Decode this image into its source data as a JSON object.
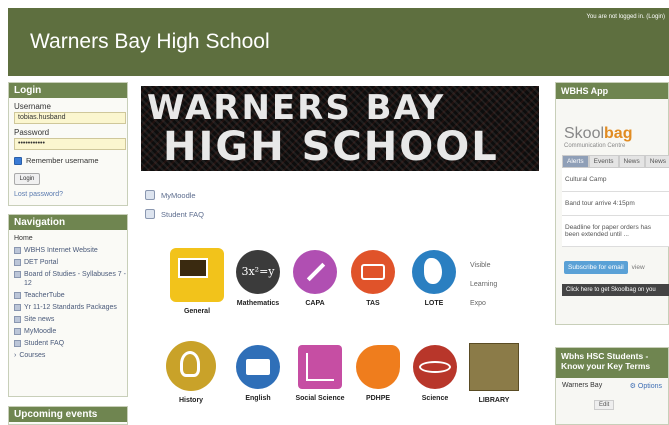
{
  "header": {
    "title": "Warners Bay High School",
    "login_info": "You are not logged in. (Login)"
  },
  "login": {
    "heading": "Login",
    "username_label": "Username",
    "username_value": "tobias.husband",
    "password_label": "Password",
    "password_value": "•••••••••••",
    "remember_label": "Remember username",
    "button_label": "Login",
    "lost_password": "Lost password?"
  },
  "navigation": {
    "heading": "Navigation",
    "items": [
      "Home",
      "WBHS Internet Website",
      "DET Portal",
      "Board of Studies - Syllabuses 7 - 12",
      "TeacherTube",
      "Yr 11-12 Standards Packages",
      "Site news",
      "MyMoodle",
      "Student FAQ",
      "Courses"
    ]
  },
  "upcoming": {
    "heading": "Upcoming events"
  },
  "banner": {
    "line1": "WARNERS BAY",
    "line2": "HIGH SCHOOL"
  },
  "center_links": [
    "MyMoodle",
    "Student FAQ"
  ],
  "subjects": [
    {
      "label": "General",
      "color": "#f2c31b"
    },
    {
      "label": "Mathematics",
      "color": "#3b3b3b",
      "glyph": "3x²=y"
    },
    {
      "label": "CAPA",
      "color": "#b04fb2"
    },
    {
      "label": "TAS",
      "color": "#e0532a"
    },
    {
      "label": "LOTE",
      "color": "#2a7fc1"
    },
    {
      "label": "History",
      "color": "#c9a229"
    },
    {
      "label": "English",
      "color": "#2f6fb8"
    },
    {
      "label": "Social Science",
      "color": "#c64ea3"
    },
    {
      "label": "PDHPE",
      "color": "#ef7d1d"
    },
    {
      "label": "Science",
      "color": "#b8362a"
    },
    {
      "label": "LIBRARY",
      "color": "#8b7b48"
    }
  ],
  "side_words": [
    "Visible",
    "Learning",
    "Expo"
  ],
  "app": {
    "heading": "WBHS App",
    "logo_a": "Skool",
    "logo_b": "bag",
    "logo_sub": "Communication Centre",
    "tabs": [
      "Alerts",
      "Events",
      "News",
      "News"
    ],
    "items": [
      "Cultural Camp",
      "Band tour arrive 4:15pm",
      "Deadline for paper orders has been extended until ..."
    ],
    "subscribe": "Subscribe for email",
    "view": "view",
    "get": "Click here to get Skoolbag on you"
  },
  "terms": {
    "heading": "Wbhs HSC Students - Know your Key Terms",
    "location": "Warners Bay",
    "options": "Options",
    "edit": "Edit"
  }
}
